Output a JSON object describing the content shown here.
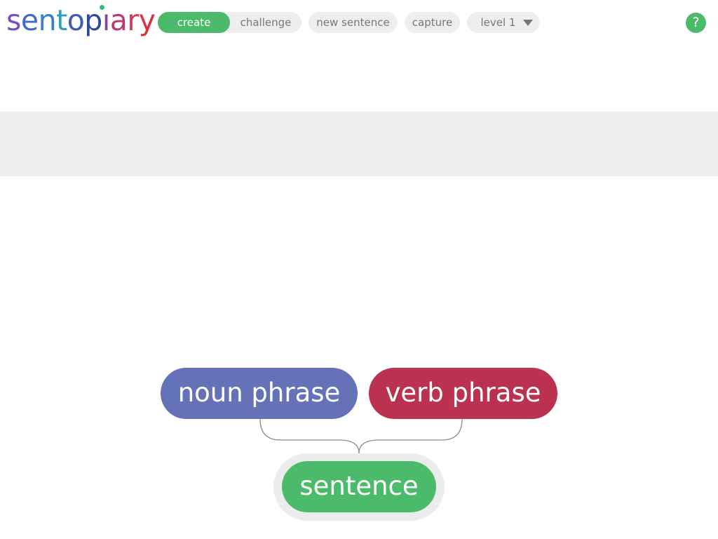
{
  "app": {
    "logo_letters": [
      {
        "ch": "s",
        "color": "#7b4fb8"
      },
      {
        "ch": "e",
        "color": "#3f6cc4"
      },
      {
        "ch": "n",
        "color": "#3a7fcb"
      },
      {
        "ch": "t",
        "color": "#2f9fb8"
      },
      {
        "ch": "o",
        "color": "#3b5fb0"
      },
      {
        "ch": "p",
        "color": "#2c4a9c"
      },
      {
        "ch": "ı",
        "color": "#8a3fa8"
      },
      {
        "ch": "a",
        "color": "#c0396e"
      },
      {
        "ch": "r",
        "color": "#d23a55"
      },
      {
        "ch": "y",
        "color": "#d8343f"
      }
    ],
    "logo_dot_color": "#2fbf6a"
  },
  "toolbar": {
    "mode_create_label": "create",
    "mode_challenge_label": "challenge",
    "active_mode": "create",
    "new_sentence_label": "new sentence",
    "capture_label": "capture",
    "level_label": "level 1",
    "help_label": "?"
  },
  "sentence_band": {
    "text": ""
  },
  "tree": {
    "root": {
      "label": "sentence",
      "color": "#4cba6b"
    },
    "children": [
      {
        "label": "noun phrase",
        "color": "#6672b8"
      },
      {
        "label": "verb phrase",
        "color": "#bb3250"
      }
    ]
  },
  "colors": {
    "accent": "#4cba6b",
    "pill_bg": "#eeeeee",
    "pill_text": "#777777",
    "band_bg": "#eeeded"
  }
}
